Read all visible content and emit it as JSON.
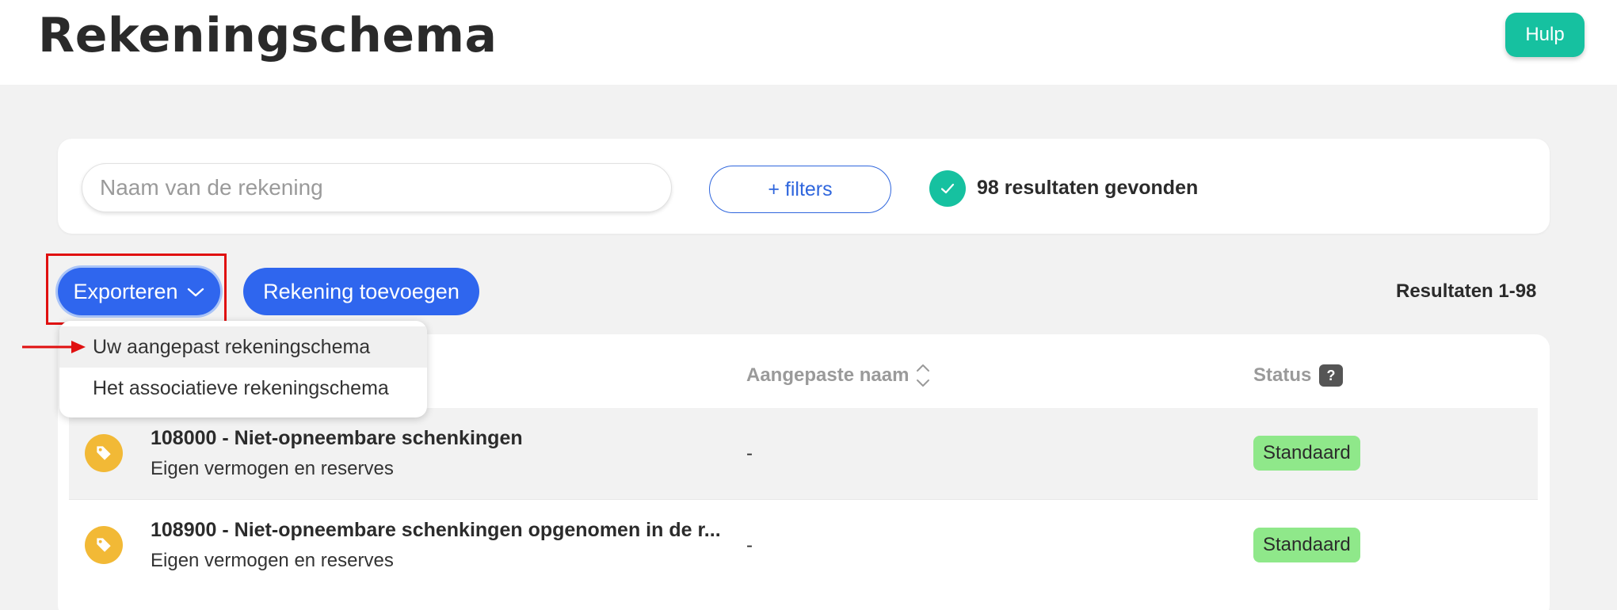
{
  "header": {
    "title": "Rekeningschema",
    "help_label": "Hulp"
  },
  "search": {
    "placeholder": "Naam van de rekening",
    "filters_label": "+ filters",
    "results_found": "98 resultaten gevonden"
  },
  "toolbar": {
    "export_label": "Exporteren",
    "add_account_label": "Rekening toevoegen",
    "results_range": "Resultaten 1-98"
  },
  "dropdown": {
    "items": [
      {
        "label": "Uw aangepast rekeningschema"
      },
      {
        "label": "Het associatieve rekeningschema"
      }
    ]
  },
  "table": {
    "columns": {
      "custom_name": "Aangepaste naam",
      "status": "Status",
      "status_help": "?"
    },
    "rows": [
      {
        "title": "108000 - Niet-opneembare schenkingen",
        "subtitle": "Eigen vermogen en reserves",
        "custom_name": "-",
        "status": "Standaard"
      },
      {
        "title": "108900 - Niet-opneembare schenkingen opgenomen in de r...",
        "subtitle": "Eigen vermogen en reserves",
        "custom_name": "-",
        "status": "Standaard"
      }
    ]
  },
  "colors": {
    "accent": "#2f66ee",
    "teal": "#16c1a0",
    "status_green": "#8fe88a",
    "tag_yellow": "#f2b936",
    "highlight_red": "#e01010"
  },
  "icons": {
    "check": "check-icon",
    "chevron": "chevron-down-icon",
    "sort": "sort-icon",
    "tag": "tag-icon",
    "arrow": "arrow-right-icon"
  }
}
